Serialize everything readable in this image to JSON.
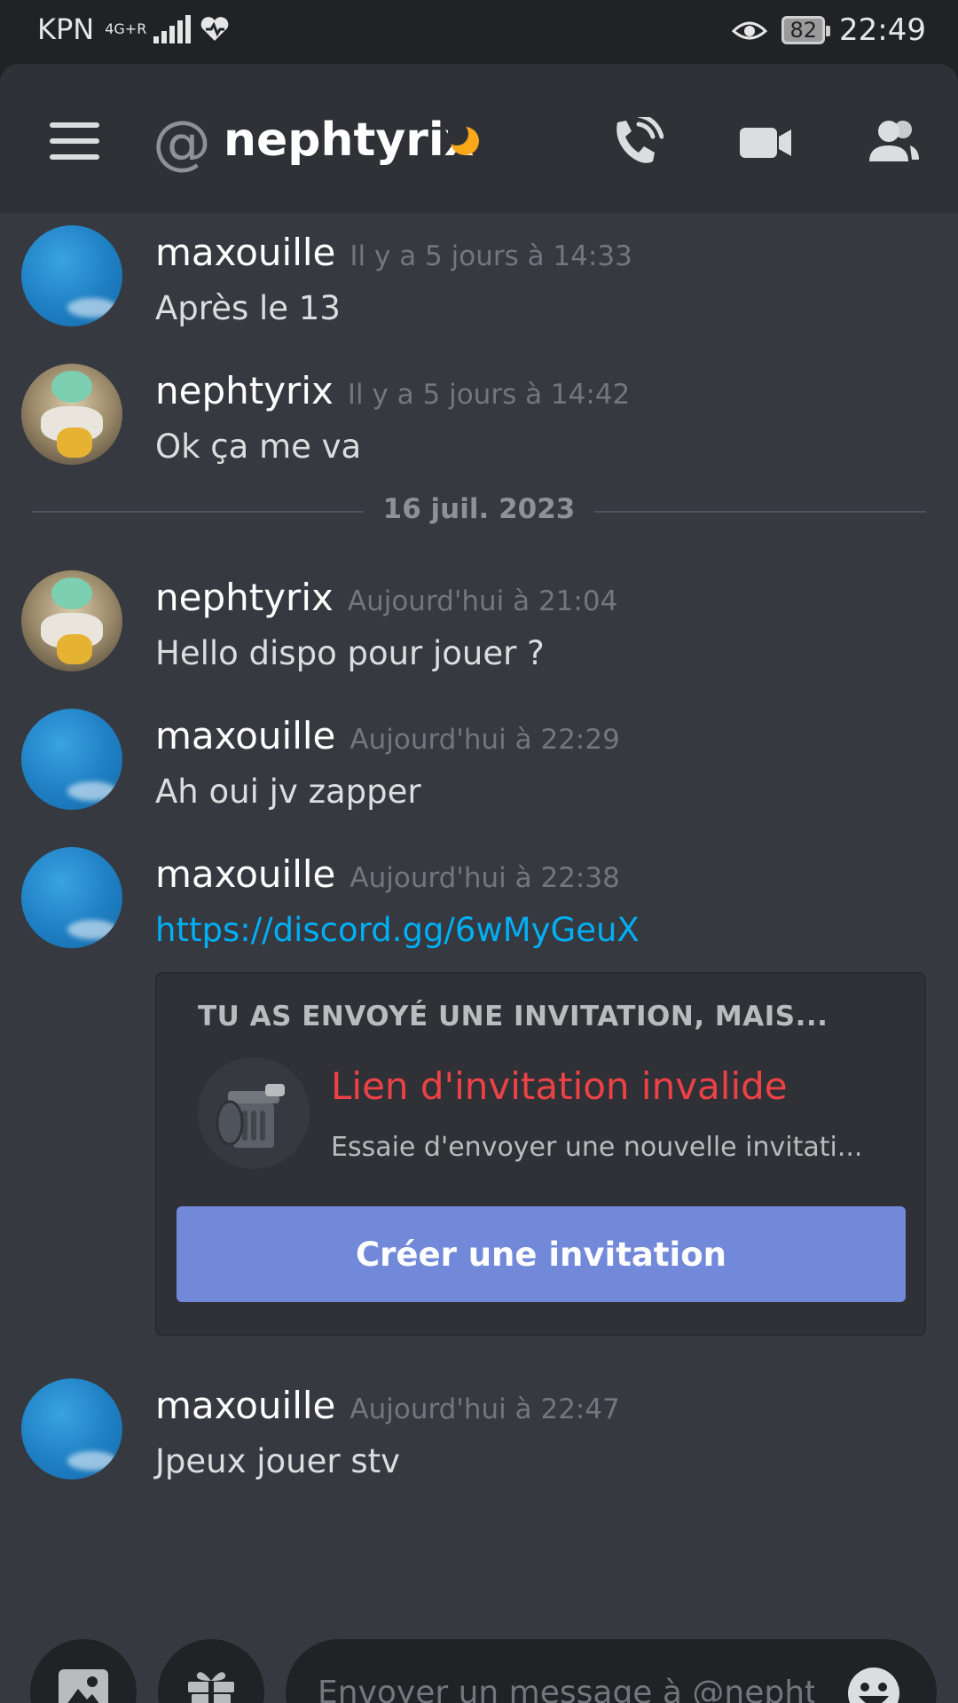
{
  "statusbar": {
    "carrier": "KPN",
    "network": "4G+R",
    "battery": "82",
    "time": "22:49"
  },
  "header": {
    "title": "nephtyrix",
    "at_symbol": "@",
    "status": "idle"
  },
  "messages": [
    {
      "author": "maxouille",
      "timestamp": "Il y a 5 jours à 14:33",
      "content": "Après le 13",
      "avatar": "blue"
    },
    {
      "author": "nephtyrix",
      "timestamp": "Il y a 5 jours à 14:42",
      "content": "Ok ça me va",
      "avatar": "frog"
    },
    {
      "author": "nephtyrix",
      "timestamp": "Aujourd'hui à 21:04",
      "content": "Hello dispo pour jouer ?",
      "avatar": "frog"
    },
    {
      "author": "maxouille",
      "timestamp": "Aujourd'hui à 22:29",
      "content": "Ah oui jv zapper",
      "avatar": "blue"
    },
    {
      "author": "maxouille",
      "timestamp": "Aujourd'hui à 22:38",
      "content": "https://discord.gg/6wMyGeuX",
      "avatar": "blue"
    },
    {
      "author": "maxouille",
      "timestamp": "Aujourd'hui à 22:47",
      "content": "Jpeux jouer stv",
      "avatar": "blue"
    }
  ],
  "date_divider": "16 juil. 2023",
  "invite": {
    "heading": "TU AS ENVOYÉ UNE INVITATION, MAIS...",
    "title": "Lien d'invitation invalide",
    "subtitle": "Essaie d'envoyer une nouvelle invitati...",
    "button_label": "Créer une invitation"
  },
  "composer": {
    "placeholder": "Envoyer un message à @nepht..."
  },
  "colors": {
    "background": "#36393f",
    "header": "#2f3136",
    "accent": "#7289da",
    "link": "#00aff4",
    "error": "#ed4245",
    "idle": "#faa81a"
  }
}
